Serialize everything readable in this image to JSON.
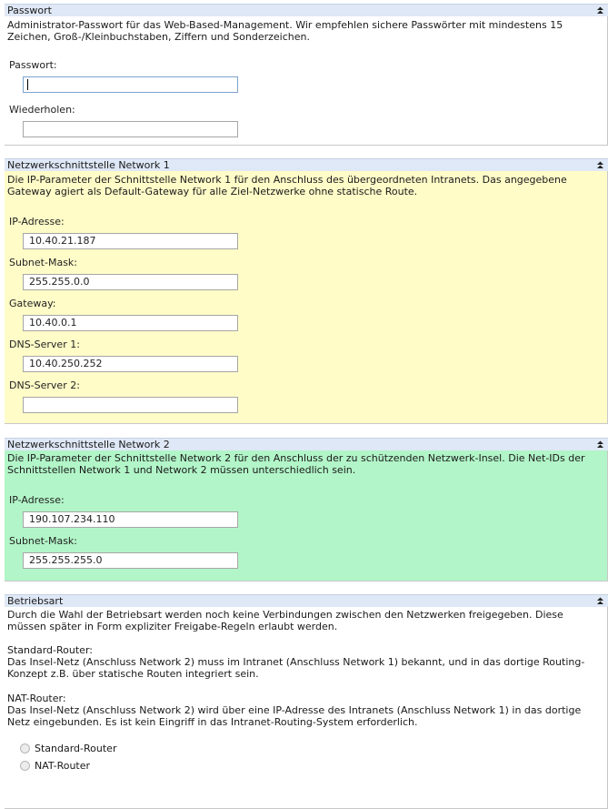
{
  "colors": {
    "header_bg": "#dfe8f6",
    "network1_bg": "#fffcc8",
    "network2_bg": "#b2f5c8"
  },
  "password": {
    "title": "Passwort",
    "description": "Administrator-Passwort für das Web-Based-Management. Wir empfehlen sichere Passwörter mit mindestens 15 Zeichen, Groß-/Kleinbuchstaben, Ziffern und Sonderzeichen.",
    "password_label": "Passwort:",
    "password_value": "",
    "repeat_label": "Wiederholen:",
    "repeat_value": ""
  },
  "network1": {
    "title": "Netzwerkschnittstelle Network 1",
    "description": "Die IP-Parameter der Schnittstelle Network 1 für den Anschluss des übergeordneten Intranets. Das angegebene Gateway agiert als Default-Gateway für alle Ziel-Netzwerke ohne statische Route.",
    "ip_label": "IP-Adresse:",
    "ip_value": "10.40.21.187",
    "mask_label": "Subnet-Mask:",
    "mask_value": "255.255.0.0",
    "gateway_label": "Gateway:",
    "gateway_value": "10.40.0.1",
    "dns1_label": "DNS-Server 1:",
    "dns1_value": "10.40.250.252",
    "dns2_label": "DNS-Server 2:",
    "dns2_value": ""
  },
  "network2": {
    "title": "Netzwerkschnittstelle Network 2",
    "description": "Die IP-Parameter der Schnittstelle Network 2 für den Anschluss der zu schützenden Netzwerk-Insel. Die Net-IDs der Schnittstellen Network 1 und Network 2 müssen unterschiedlich sein.",
    "ip_label": "IP-Adresse:",
    "ip_value": "190.107.234.110",
    "mask_label": "Subnet-Mask:",
    "mask_value": "255.255.255.0"
  },
  "mode": {
    "title": "Betriebsart",
    "description": "Durch die Wahl der Betriebsart werden noch keine Verbindungen zwischen den Netzwerken freigegeben. Diese müssen später in Form expliziter Freigabe-Regeln erlaubt werden.",
    "standard_heading": "Standard-Router:",
    "standard_text": "Das Insel-Netz (Anschluss Network 2) muss im Intranet (Anschluss Network 1) bekannt, und in das dortige Routing-Konzept z.B. über statische Routen integriert sein.",
    "nat_heading": "NAT-Router:",
    "nat_text": "Das Insel-Netz (Anschluss Network 2) wird über eine IP-Adresse des Intranets (Anschluss Network 1) in das dortige Netz eingebunden. Es ist kein Eingriff in das Intranet-Routing-System erforderlich.",
    "options": [
      "Standard-Router",
      "NAT-Router"
    ]
  }
}
